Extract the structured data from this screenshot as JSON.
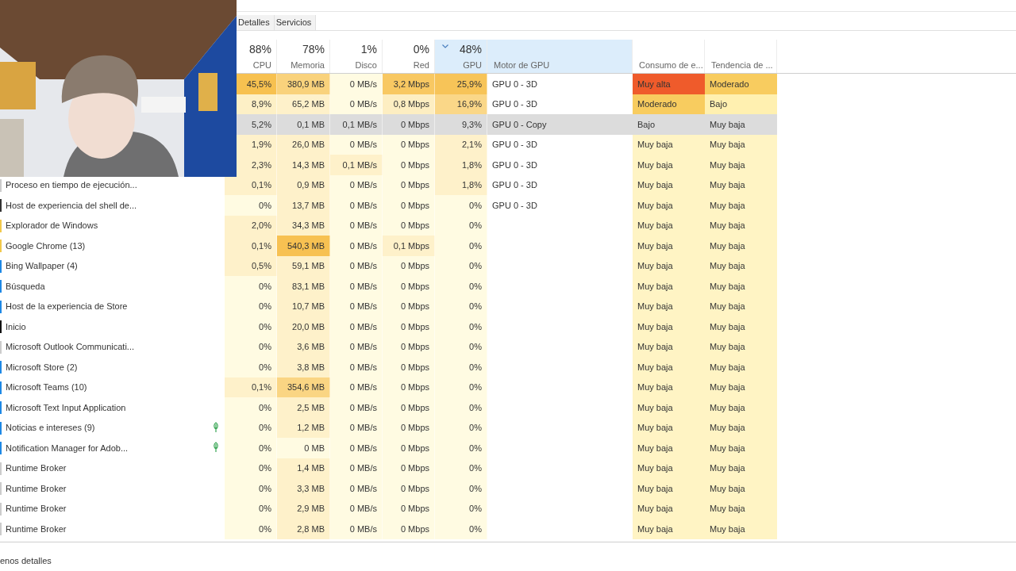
{
  "tabs": [
    {
      "label": "Detalles",
      "selected": false
    },
    {
      "label": "Servicios",
      "selected": false
    }
  ],
  "columns": [
    {
      "label": "CPU",
      "percent": "88%",
      "highlighted": false,
      "sorted": false
    },
    {
      "label": "Memoria",
      "percent": "78%",
      "highlighted": false,
      "sorted": false
    },
    {
      "label": "Disco",
      "percent": "1%",
      "highlighted": false,
      "sorted": false
    },
    {
      "label": "Red",
      "percent": "0%",
      "highlighted": false,
      "sorted": false
    },
    {
      "label": "GPU",
      "percent": "48%",
      "highlighted": true,
      "sorted": true
    },
    {
      "label": "Motor de GPU",
      "highlighted": true,
      "sorted": false
    },
    {
      "label": "Consumo de e...",
      "highlighted": false,
      "sorted": false
    },
    {
      "label": "Tendencia de ...",
      "highlighted": false,
      "sorted": false
    }
  ],
  "rows": [
    {
      "selected": false,
      "eco": false,
      "cpu": "45,5%",
      "memory": "380,9 MB",
      "disk": "0 MB/s",
      "network": "3,2 Mbps",
      "gpu": "25,9%",
      "gpu_engine": "GPU 0 - 3D",
      "power": {
        "text": "Muy alta",
        "color": "#ef5b2b"
      },
      "trend": {
        "text": "Moderado",
        "color": "#f8cc5f"
      }
    },
    {
      "selected": false,
      "eco": false,
      "cpu": "8,9%",
      "memory": "65,2 MB",
      "disk": "0 MB/s",
      "network": "0,8 Mbps",
      "gpu": "16,9%",
      "gpu_engine": "GPU 0 - 3D",
      "power": {
        "text": "Moderado",
        "color": "#f8cc5f"
      },
      "trend": {
        "text": "Bajo",
        "color": "#fff0b0"
      }
    },
    {
      "selected": true,
      "eco": false,
      "cpu": "5,2%",
      "memory": "0,1 MB",
      "disk": "0,1 MB/s",
      "network": "0 Mbps",
      "gpu": "9,3%",
      "gpu_engine": "GPU 0 - Copy",
      "power": {
        "text": "Bajo",
        "color": "#dcdcdc"
      },
      "trend": {
        "text": "Muy baja",
        "color": "#dcdcdc"
      }
    },
    {
      "selected": false,
      "eco": false,
      "cpu": "1,9%",
      "memory": "26,0 MB",
      "disk": "0 MB/s",
      "network": "0 Mbps",
      "gpu": "2,1%",
      "gpu_engine": "GPU 0 - 3D",
      "power": {
        "text": "Muy baja",
        "color": "#fff4c4"
      },
      "trend": {
        "text": "Muy baja",
        "color": "#fff4c4"
      }
    },
    {
      "selected": false,
      "eco": false,
      "cpu": "2,3%",
      "memory": "14,3 MB",
      "disk": "0,1 MB/s",
      "network": "0 Mbps",
      "gpu": "1,8%",
      "gpu_engine": "GPU 0 - 3D",
      "power": {
        "text": "Muy baja",
        "color": "#fff4c4"
      },
      "trend": {
        "text": "Muy baja",
        "color": "#fff4c4"
      }
    },
    {
      "name": "Proceso en tiempo de ejecución...",
      "color": "#cccccc",
      "selected": false,
      "eco": false,
      "cpu": "0,1%",
      "memory": "0,9 MB",
      "disk": "0 MB/s",
      "network": "0 Mbps",
      "gpu": "1,8%",
      "gpu_engine": "GPU 0 - 3D",
      "power": {
        "text": "Muy baja",
        "color": "#fff4c4"
      },
      "trend": {
        "text": "Muy baja",
        "color": "#fff4c4"
      }
    },
    {
      "name": "Host de experiencia del shell de...",
      "color": "#333333",
      "selected": false,
      "eco": false,
      "cpu": "0%",
      "memory": "13,7 MB",
      "disk": "0 MB/s",
      "network": "0 Mbps",
      "gpu": "0%",
      "gpu_engine": "GPU 0 - 3D",
      "power": {
        "text": "Muy baja",
        "color": "#fff4c4"
      },
      "trend": {
        "text": "Muy baja",
        "color": "#fff4c4"
      }
    },
    {
      "name": "Explorador de Windows",
      "color": "#f2c94c",
      "selected": false,
      "eco": false,
      "cpu": "2,0%",
      "memory": "34,3 MB",
      "disk": "0 MB/s",
      "network": "0 Mbps",
      "gpu": "0%",
      "power": {
        "text": "Muy baja",
        "color": "#fff4c4"
      },
      "trend": {
        "text": "Muy baja",
        "color": "#fff4c4"
      }
    },
    {
      "name": "Google Chrome (13)",
      "color": "#f2c94c",
      "selected": false,
      "eco": false,
      "cpu": "0,1%",
      "memory": "540,3 MB",
      "disk": "0 MB/s",
      "network": "0,1 Mbps",
      "gpu": "0%",
      "power": {
        "text": "Muy baja",
        "color": "#fff4c4"
      },
      "trend": {
        "text": "Muy baja",
        "color": "#fff4c4"
      }
    },
    {
      "name": "Bing Wallpaper (4)",
      "color": "#1e88e5",
      "selected": false,
      "eco": false,
      "cpu": "0,5%",
      "memory": "59,1 MB",
      "disk": "0 MB/s",
      "network": "0 Mbps",
      "gpu": "0%",
      "power": {
        "text": "Muy baja",
        "color": "#fff4c4"
      },
      "trend": {
        "text": "Muy baja",
        "color": "#fff4c4"
      }
    },
    {
      "name": "Búsqueda",
      "color": "#1e88e5",
      "selected": false,
      "eco": false,
      "cpu": "0%",
      "memory": "83,1 MB",
      "disk": "0 MB/s",
      "network": "0 Mbps",
      "gpu": "0%",
      "power": {
        "text": "Muy baja",
        "color": "#fff4c4"
      },
      "trend": {
        "text": "Muy baja",
        "color": "#fff4c4"
      }
    },
    {
      "name": "Host de la experiencia de Store",
      "color": "#1e88e5",
      "selected": false,
      "eco": false,
      "cpu": "0%",
      "memory": "10,7 MB",
      "disk": "0 MB/s",
      "network": "0 Mbps",
      "gpu": "0%",
      "power": {
        "text": "Muy baja",
        "color": "#fff4c4"
      },
      "trend": {
        "text": "Muy baja",
        "color": "#fff4c4"
      }
    },
    {
      "name": "Inicio",
      "color": "#111111",
      "selected": false,
      "eco": false,
      "cpu": "0%",
      "memory": "20,0 MB",
      "disk": "0 MB/s",
      "network": "0 Mbps",
      "gpu": "0%",
      "power": {
        "text": "Muy baja",
        "color": "#fff4c4"
      },
      "trend": {
        "text": "Muy baja",
        "color": "#fff4c4"
      }
    },
    {
      "name": "Microsoft Outlook Communicati...",
      "color": "#cccccc",
      "selected": false,
      "eco": false,
      "cpu": "0%",
      "memory": "3,6 MB",
      "disk": "0 MB/s",
      "network": "0 Mbps",
      "gpu": "0%",
      "power": {
        "text": "Muy baja",
        "color": "#fff4c4"
      },
      "trend": {
        "text": "Muy baja",
        "color": "#fff4c4"
      }
    },
    {
      "name": "Microsoft Store (2)",
      "color": "#1e88e5",
      "selected": false,
      "eco": false,
      "cpu": "0%",
      "memory": "3,8 MB",
      "disk": "0 MB/s",
      "network": "0 Mbps",
      "gpu": "0%",
      "power": {
        "text": "Muy baja",
        "color": "#fff4c4"
      },
      "trend": {
        "text": "Muy baja",
        "color": "#fff4c4"
      }
    },
    {
      "name": "Microsoft Teams (10)",
      "color": "#1e88e5",
      "selected": false,
      "eco": false,
      "cpu": "0,1%",
      "memory": "354,6 MB",
      "disk": "0 MB/s",
      "network": "0 Mbps",
      "gpu": "0%",
      "power": {
        "text": "Muy baja",
        "color": "#fff4c4"
      },
      "trend": {
        "text": "Muy baja",
        "color": "#fff4c4"
      }
    },
    {
      "name": "Microsoft Text Input Application",
      "color": "#1e88e5",
      "selected": false,
      "eco": false,
      "cpu": "0%",
      "memory": "2,5 MB",
      "disk": "0 MB/s",
      "network": "0 Mbps",
      "gpu": "0%",
      "power": {
        "text": "Muy baja",
        "color": "#fff4c4"
      },
      "trend": {
        "text": "Muy baja",
        "color": "#fff4c4"
      }
    },
    {
      "name": "Noticias e intereses (9)",
      "color": "#1e88e5",
      "selected": false,
      "eco": true,
      "cpu": "0%",
      "memory": "1,2 MB",
      "disk": "0 MB/s",
      "network": "0 Mbps",
      "gpu": "0%",
      "power": {
        "text": "Muy baja",
        "color": "#fff4c4"
      },
      "trend": {
        "text": "Muy baja",
        "color": "#fff4c4"
      }
    },
    {
      "name": "Notification Manager for Adob...",
      "color": "#1e88e5",
      "selected": false,
      "eco": true,
      "cpu": "0%",
      "memory": "0 MB",
      "disk": "0 MB/s",
      "network": "0 Mbps",
      "gpu": "0%",
      "power": {
        "text": "Muy baja",
        "color": "#fff4c4"
      },
      "trend": {
        "text": "Muy baja",
        "color": "#fff4c4"
      }
    },
    {
      "name": "Runtime Broker",
      "color": "#cccccc",
      "selected": false,
      "eco": false,
      "cpu": "0%",
      "memory": "1,4 MB",
      "disk": "0 MB/s",
      "network": "0 Mbps",
      "gpu": "0%",
      "power": {
        "text": "Muy baja",
        "color": "#fff4c4"
      },
      "trend": {
        "text": "Muy baja",
        "color": "#fff4c4"
      }
    },
    {
      "name": "Runtime Broker",
      "color": "#cccccc",
      "selected": false,
      "eco": false,
      "cpu": "0%",
      "memory": "3,3 MB",
      "disk": "0 MB/s",
      "network": "0 Mbps",
      "gpu": "0%",
      "power": {
        "text": "Muy baja",
        "color": "#fff4c4"
      },
      "trend": {
        "text": "Muy baja",
        "color": "#fff4c4"
      }
    },
    {
      "name": "Runtime Broker",
      "color": "#cccccc",
      "selected": false,
      "eco": false,
      "cpu": "0%",
      "memory": "2,9 MB",
      "disk": "0 MB/s",
      "network": "0 Mbps",
      "gpu": "0%",
      "power": {
        "text": "Muy baja",
        "color": "#fff4c4"
      },
      "trend": {
        "text": "Muy baja",
        "color": "#fff4c4"
      }
    },
    {
      "name": "Runtime Broker",
      "color": "#cccccc",
      "selected": false,
      "eco": false,
      "cpu": "0%",
      "memory": "2,8 MB",
      "disk": "0 MB/s",
      "network": "0 Mbps",
      "gpu": "0%",
      "power": {
        "text": "Muy baja",
        "color": "#fff4c4"
      },
      "trend": {
        "text": "Muy baja",
        "color": "#fff4c4"
      }
    }
  ],
  "footer_link": "enos detalles"
}
